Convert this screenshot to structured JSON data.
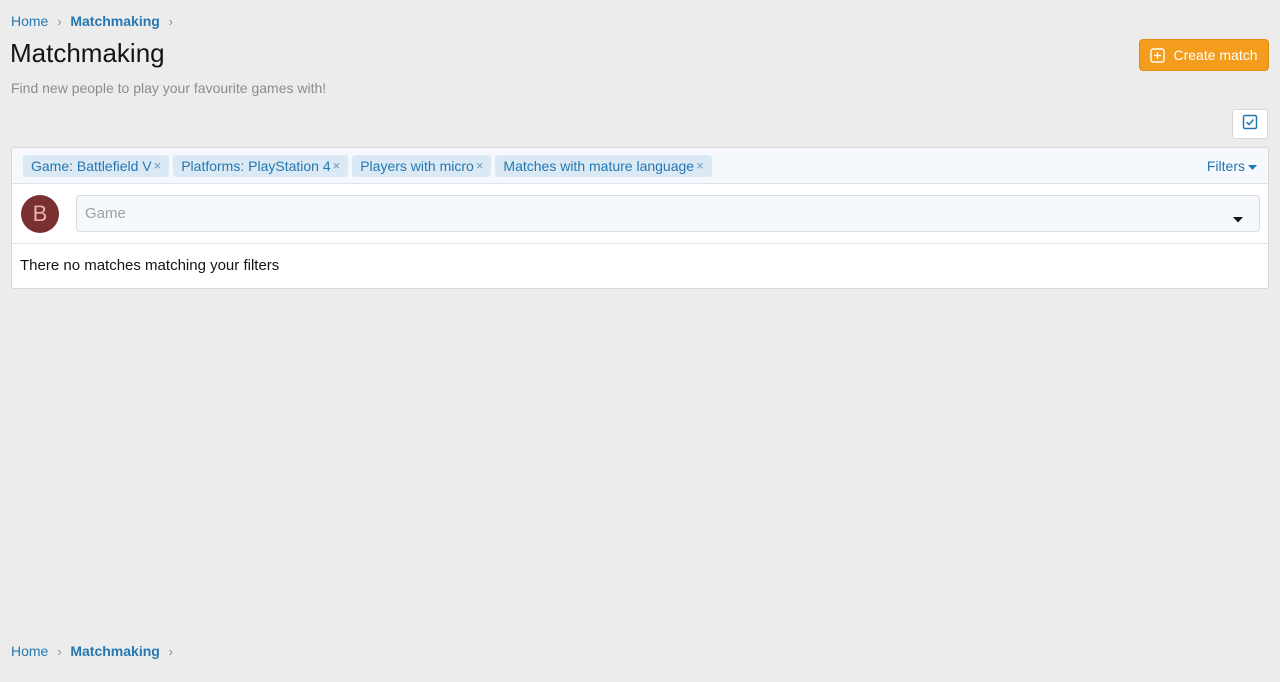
{
  "breadcrumb": {
    "home": "Home",
    "current": "Matchmaking",
    "separator": "›"
  },
  "page": {
    "title": "Matchmaking",
    "description": "Find new people to play your favourite games with!"
  },
  "actions": {
    "create_label": "Create match",
    "create_icon": "plus-square-icon",
    "select_icon": "checkbox-icon"
  },
  "filters": {
    "chips": [
      {
        "label": "Game: Battlefield V",
        "remove": "×"
      },
      {
        "label": "Platforms: PlayStation 4",
        "remove": "×"
      },
      {
        "label": "Players with micro",
        "remove": "×"
      },
      {
        "label": "Matches with mature language",
        "remove": "×"
      }
    ],
    "toggle_label": "Filters"
  },
  "game_picker": {
    "avatar_letter": "B",
    "placeholder": "Game"
  },
  "empty_message": "There no matches matching your filters",
  "colors": {
    "accent": "#2577b1",
    "button": "#f49d1c",
    "avatar_bg": "#7a3030",
    "background": "#ececec"
  }
}
